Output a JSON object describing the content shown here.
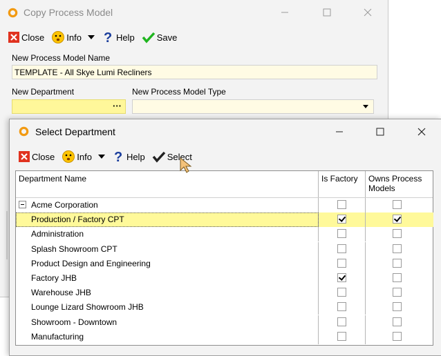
{
  "main_window": {
    "title": "Copy Process Model",
    "toolbar": {
      "close": "Close",
      "info": "Info",
      "help": "Help",
      "save": "Save"
    },
    "name_label": "New Process Model Name",
    "name_value": "TEMPLATE - All Skye Lumi Recliners",
    "department_label": "New Department",
    "department_value": "",
    "type_label": "New Process Model Type",
    "type_value": ""
  },
  "dialog": {
    "title": "Select Department",
    "toolbar": {
      "close": "Close",
      "info": "Info",
      "help": "Help",
      "select": "Select"
    },
    "columns": {
      "name": "Department Name",
      "factory": "Is Factory",
      "owns": "Owns Process Models"
    },
    "rows": [
      {
        "name": "Acme Corporation",
        "is_factory": false,
        "owns_process_models": false,
        "parent": true,
        "selected": false
      },
      {
        "name": "Production / Factory CPT",
        "is_factory": true,
        "owns_process_models": true,
        "parent": false,
        "selected": true
      },
      {
        "name": "Administration",
        "is_factory": false,
        "owns_process_models": false,
        "parent": false,
        "selected": false
      },
      {
        "name": "Splash Showroom CPT",
        "is_factory": false,
        "owns_process_models": false,
        "parent": false,
        "selected": false
      },
      {
        "name": "Product Design and Engineering",
        "is_factory": false,
        "owns_process_models": false,
        "parent": false,
        "selected": false
      },
      {
        "name": "Factory JHB",
        "is_factory": true,
        "owns_process_models": false,
        "parent": false,
        "selected": false
      },
      {
        "name": "Warehouse JHB",
        "is_factory": false,
        "owns_process_models": false,
        "parent": false,
        "selected": false
      },
      {
        "name": "Lounge Lizard Showroom JHB",
        "is_factory": false,
        "owns_process_models": false,
        "parent": false,
        "selected": false
      },
      {
        "name": "Showroom - Downtown",
        "is_factory": false,
        "owns_process_models": false,
        "parent": false,
        "selected": false
      },
      {
        "name": "Manufacturing",
        "is_factory": false,
        "owns_process_models": false,
        "parent": false,
        "selected": false
      }
    ]
  },
  "icons": {
    "logo": "app-logo-icon",
    "close": "close-icon",
    "info": "info-smiley-icon",
    "help": "help-icon",
    "save": "checkmark-icon",
    "select": "checkmark-icon"
  },
  "colors": {
    "field_bg": "#fffbe4",
    "required_field_bg": "#fff79a",
    "selection_bg": "#fff99a",
    "accent_green": "#1fb51f"
  }
}
